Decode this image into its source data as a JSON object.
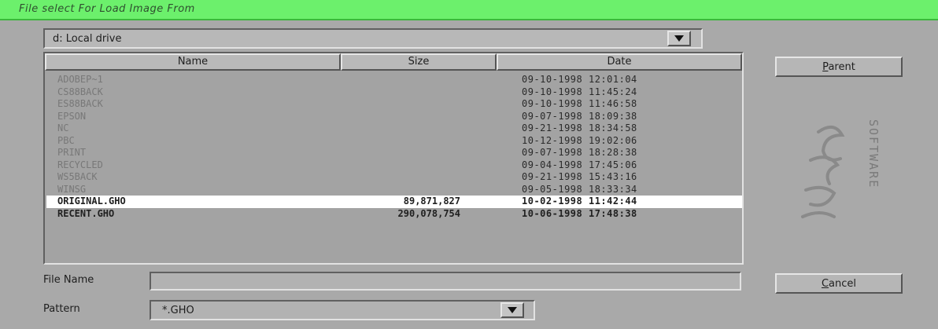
{
  "window": {
    "title": "File select For Load Image From"
  },
  "drive": {
    "value": "d: Local drive"
  },
  "list": {
    "columns": [
      "Name",
      "Size",
      "Date"
    ],
    "rows": [
      {
        "name": "ADOBEP~1",
        "size": "",
        "date": "09-10-1998 12:01:04",
        "kind": "dir",
        "selected": false
      },
      {
        "name": "CS88BACK",
        "size": "",
        "date": "09-10-1998 11:45:24",
        "kind": "dir",
        "selected": false
      },
      {
        "name": "ES88BACK",
        "size": "",
        "date": "09-10-1998 11:46:58",
        "kind": "dir",
        "selected": false
      },
      {
        "name": "EPSON",
        "size": "",
        "date": "09-07-1998 18:09:38",
        "kind": "dir",
        "selected": false
      },
      {
        "name": "NC",
        "size": "",
        "date": "09-21-1998 18:34:58",
        "kind": "dir",
        "selected": false
      },
      {
        "name": "PBC",
        "size": "",
        "date": "10-12-1998 19:02:06",
        "kind": "dir",
        "selected": false
      },
      {
        "name": "PRINT",
        "size": "",
        "date": "09-07-1998 18:28:38",
        "kind": "dir",
        "selected": false
      },
      {
        "name": "RECYCLED",
        "size": "",
        "date": "09-04-1998 17:45:06",
        "kind": "dir",
        "selected": false
      },
      {
        "name": "WS5BACK",
        "size": "",
        "date": "09-21-1998 15:43:16",
        "kind": "dir",
        "selected": false
      },
      {
        "name": "WINSG",
        "size": "",
        "date": "09-05-1998 18:33:34",
        "kind": "dir",
        "selected": false
      },
      {
        "name": "ORIGINAL.GHO",
        "size": "89,871,827",
        "date": "10-02-1998 11:42:44",
        "kind": "file",
        "selected": true
      },
      {
        "name": "RECENT.GHO",
        "size": "290,078,754",
        "date": "10-06-1998 17:48:38",
        "kind": "file",
        "selected": false
      }
    ]
  },
  "buttons": {
    "parent": "Parent",
    "cancel": "Cancel"
  },
  "filename": {
    "label": "File Name",
    "value": ""
  },
  "pattern": {
    "label": "Pattern",
    "value": "*.GHO"
  },
  "logo": {
    "text": "Ghost",
    "subtext": "SOFTWARE"
  },
  "colors": {
    "titlebar": "#6cf06c",
    "background": "#a9a9a9",
    "selection": "#ffffff"
  },
  "icons": {
    "dropdown": "chevron-down-icon"
  }
}
